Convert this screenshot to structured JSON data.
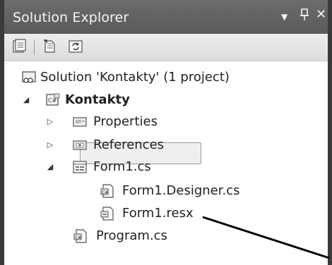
{
  "panel": {
    "title": "Solution Explorer",
    "title_icons": [
      "dropdown-arrow-icon",
      "pin-icon",
      "close-icon"
    ],
    "toolbar_icons": [
      "properties-icon",
      "show-all-files-icon",
      "refresh-icon"
    ]
  },
  "tree": {
    "solution": "Solution 'Kontakty' (1 project)",
    "project": "Kontakty",
    "properties": "Properties",
    "references": "References",
    "form": "Form1.cs",
    "designer": "Form1.Designer.cs",
    "resx": "Form1.resx",
    "program": "Program.cs"
  }
}
